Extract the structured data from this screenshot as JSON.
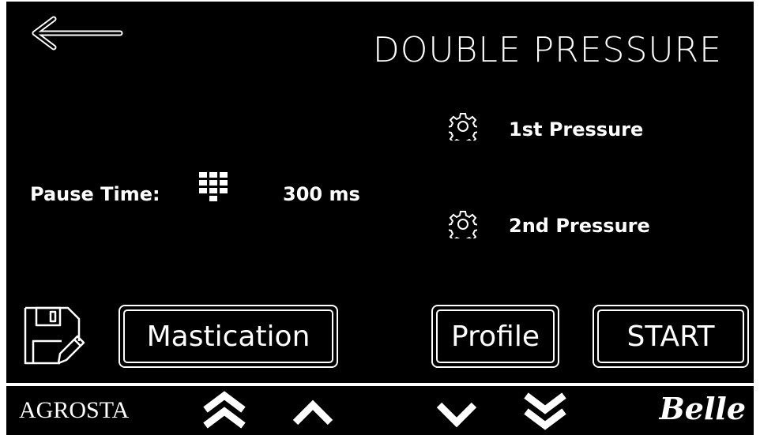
{
  "header": {
    "title": "DOUBLE PRESSURE"
  },
  "pause": {
    "label": "Pause Time:",
    "value": "300 ms"
  },
  "pressures": [
    {
      "label": "1st  Pressure"
    },
    {
      "label": "2nd Pressure"
    }
  ],
  "buttons": {
    "mastication": "Mastication",
    "profile": "Profile",
    "start": "START"
  },
  "footer": {
    "brand_left": "AGROSTA",
    "brand_right": "Belle"
  }
}
